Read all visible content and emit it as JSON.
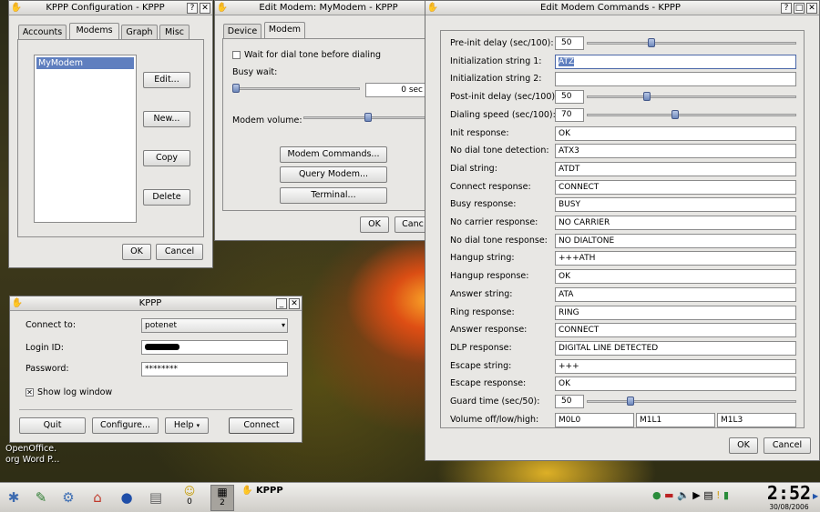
{
  "cfg": {
    "title": "KPPP Configuration - KPPP",
    "tabs": [
      "Accounts",
      "Modems",
      "Graph",
      "Misc"
    ],
    "modems": [
      "MyModem"
    ],
    "edit": "Edit...",
    "new": "New...",
    "copy": "Copy",
    "delete": "Delete",
    "ok": "OK",
    "cancel": "Cancel"
  },
  "em": {
    "title": "Edit Modem: MyModem - KPPP",
    "tabs": [
      "Device",
      "Modem"
    ],
    "wait_label": "Wait for dial tone before dialing",
    "busy_label": "Busy wait:",
    "busy_value": "0 sec",
    "volume_label": "Modem volume:",
    "modem_commands": "Modem Commands...",
    "query_modem": "Query Modem...",
    "terminal": "Terminal...",
    "ok": "OK",
    "cancel": "Canc"
  },
  "emc": {
    "title": "Edit Modem Commands - KPPP",
    "rows": [
      {
        "label": "Pre-init delay (sec/100):",
        "type": "slider",
        "value": "50",
        "level": 0.3
      },
      {
        "label": "Initialization string 1:",
        "type": "text",
        "value": "ATZ"
      },
      {
        "label": "Initialization string 2:",
        "type": "text",
        "value": ""
      },
      {
        "label": "Post-init delay (sec/100):",
        "type": "slider",
        "value": "50",
        "level": 0.28
      },
      {
        "label": "Dialing speed (sec/100):",
        "type": "slider",
        "value": "70",
        "level": 0.42
      },
      {
        "label": "Init response:",
        "type": "text",
        "value": "OK"
      },
      {
        "label": "No dial tone detection:",
        "type": "text",
        "value": "ATX3"
      },
      {
        "label": "Dial string:",
        "type": "text",
        "value": "ATDT"
      },
      {
        "label": "Connect response:",
        "type": "text",
        "value": "CONNECT"
      },
      {
        "label": "Busy response:",
        "type": "text",
        "value": "BUSY"
      },
      {
        "label": "No carrier response:",
        "type": "text",
        "value": "NO CARRIER"
      },
      {
        "label": "No dial tone response:",
        "type": "text",
        "value": "NO DIALTONE"
      },
      {
        "label": "Hangup string:",
        "type": "text",
        "value": "+++ATH"
      },
      {
        "label": "Hangup response:",
        "type": "text",
        "value": "OK"
      },
      {
        "label": "Answer string:",
        "type": "text",
        "value": "ATA"
      },
      {
        "label": "Ring response:",
        "type": "text",
        "value": "RING"
      },
      {
        "label": "Answer response:",
        "type": "text",
        "value": "CONNECT"
      },
      {
        "label": "DLP response:",
        "type": "text",
        "value": "DIGITAL LINE DETECTED"
      },
      {
        "label": "Escape string:",
        "type": "text",
        "value": "+++"
      },
      {
        "label": "Escape response:",
        "type": "text",
        "value": "OK"
      },
      {
        "label": "Guard time (sec/50):",
        "type": "slider",
        "value": "50",
        "level": 0.2
      }
    ],
    "volume_label": "Volume off/low/high:",
    "volumes": [
      "M0L0",
      "M1L1",
      "M1L3"
    ],
    "ok": "OK",
    "cancel": "Cancel"
  },
  "kppp": {
    "title": "KPPP",
    "connect_to_label": "Connect to:",
    "connect_to_value": "potenet",
    "login_label": "Login ID:",
    "password_label": "Password:",
    "password_value": "********",
    "show_log": "Show log window",
    "quit": "Quit",
    "configure": "Configure...",
    "help": "Help",
    "connect": "Connect"
  },
  "desktop": {
    "icon_label_1": "OpenOffice.",
    "icon_label_2": "org Word P..."
  },
  "taskbar": {
    "desk1": "0",
    "desk2": "2",
    "task": "KPPP",
    "time": "2:52",
    "date": "30/08/2006"
  }
}
